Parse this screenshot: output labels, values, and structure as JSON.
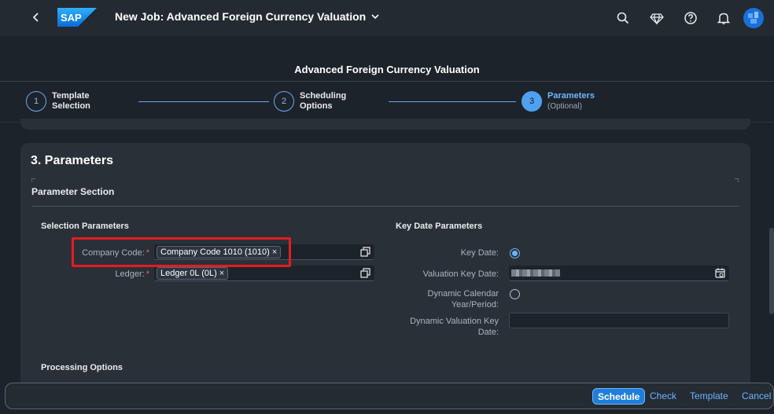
{
  "shell": {
    "title": "New Job: Advanced Foreign Currency Valuation",
    "logo_text": "SAP",
    "icons": [
      "back-icon",
      "search-icon",
      "diamond-icon",
      "help-icon",
      "bell-icon",
      "avatar"
    ]
  },
  "header": {
    "object_title": "Advanced Foreign Currency Valuation"
  },
  "wizard": {
    "steps": [
      {
        "number": "1",
        "label_line1": "Template",
        "label_line2": "Selection",
        "active": false
      },
      {
        "number": "2",
        "label_line1": "Scheduling",
        "label_line2": "Options",
        "active": false
      },
      {
        "number": "3",
        "label_line1": "Parameters",
        "label_line2": "(Optional)",
        "active": true
      }
    ]
  },
  "main": {
    "card_title": "3. Parameters",
    "section_title": "Parameter Section",
    "selection_group": {
      "title": "Selection Parameters",
      "company_code_label": "Company Code:",
      "company_code_token": "Company Code 1010 (1010)",
      "ledger_label": "Ledger:",
      "ledger_token": "Ledger 0L (0L)",
      "required_mark": "*",
      "remove_mark": "×"
    },
    "key_date_group": {
      "title": "Key Date Parameters",
      "key_date_label": "Key Date:",
      "valuation_key_date_label": "Valuation Key Date:",
      "dynamic_calendar_label_line1": "Dynamic Calendar",
      "dynamic_calendar_label_line2": "Year/Period:",
      "dynamic_valuation_label_line1": "Dynamic Valuation Key",
      "dynamic_valuation_label_line2": "Date:"
    },
    "processing_title": "Processing Options"
  },
  "footer": {
    "schedule": "Schedule",
    "check": "Check",
    "template": "Template",
    "cancel": "Cancel"
  },
  "colors": {
    "accent": "#1f7ed9",
    "link": "#6cb5ff",
    "highlight": "#e31c23",
    "background": "#1d232a"
  }
}
